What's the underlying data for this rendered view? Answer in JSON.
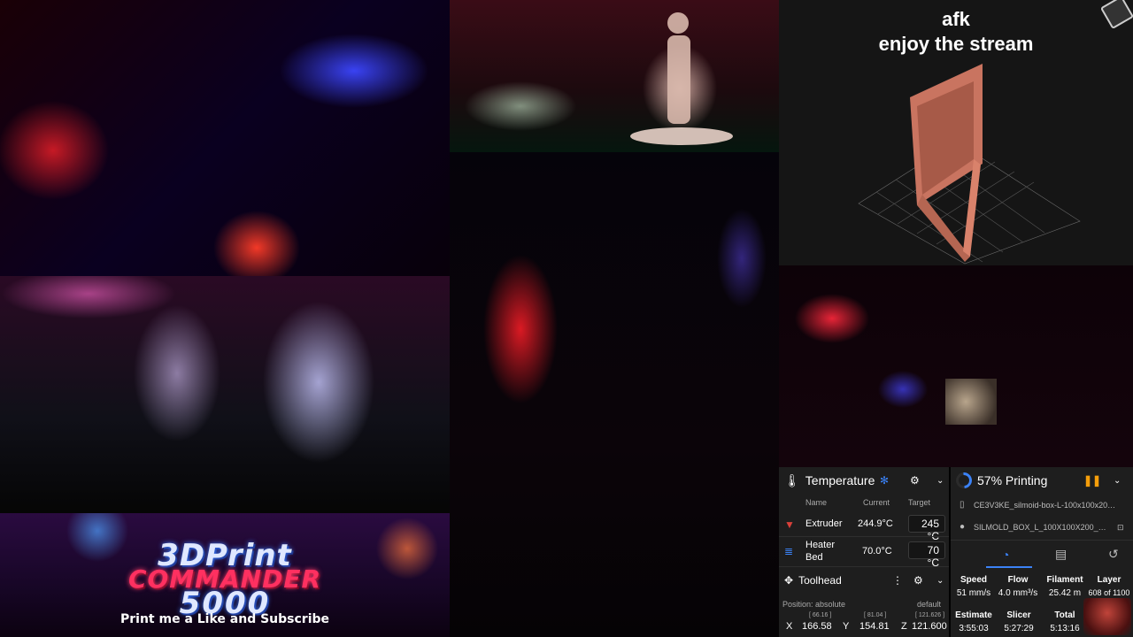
{
  "overlay": {
    "line1": "afk",
    "line2": "enjoy the stream"
  },
  "banner": {
    "line1": "3DPrint",
    "line2": "COMMANDER",
    "line3": "5000",
    "tagline": "Print me a Like and Subscribe"
  },
  "temperature": {
    "title": "Temperature",
    "headers": {
      "name": "Name",
      "current": "Current",
      "target": "Target"
    },
    "rows": [
      {
        "name": "Extruder",
        "current": "244.9°C",
        "target": "245",
        "unit": "°C"
      },
      {
        "name": "Heater\nBed",
        "name1": "Heater",
        "name2": "Bed",
        "current": "70.0°C",
        "target": "70",
        "unit": "°C"
      }
    ]
  },
  "toolhead": {
    "title": "Toolhead",
    "position_mode": "Position: absolute",
    "profile": "default",
    "axes": [
      {
        "axis": "X",
        "value": "166.58",
        "raw": "[ 66.16 ]"
      },
      {
        "axis": "Y",
        "value": "154.81",
        "raw": "[ 81.04 ]"
      },
      {
        "axis": "Z",
        "value": "121.600",
        "raw": "[ 121.626 ]"
      }
    ]
  },
  "job": {
    "status": "57% Printing",
    "progress": 57,
    "file": "CE3V3KE_silmoid-box-L-100x100x20…",
    "object": "SILMOLD_BOX_L_100X100X200_…",
    "stats": [
      {
        "label": "Speed",
        "value": "51 mm/s"
      },
      {
        "label": "Flow",
        "value": "4.0 mm³/s"
      },
      {
        "label": "Filament",
        "value": "25.42 m"
      },
      {
        "label": "Layer",
        "value": "608 of 1100"
      }
    ],
    "times": [
      {
        "label": "Estimate",
        "value": "3:55:03"
      },
      {
        "label": "Slicer",
        "value": "5:27:29"
      },
      {
        "label": "Total",
        "value": "5:13:16"
      }
    ]
  },
  "colors": {
    "accent": "#3b82f6",
    "pause": "#f59e0b",
    "model": "#d9826b"
  }
}
